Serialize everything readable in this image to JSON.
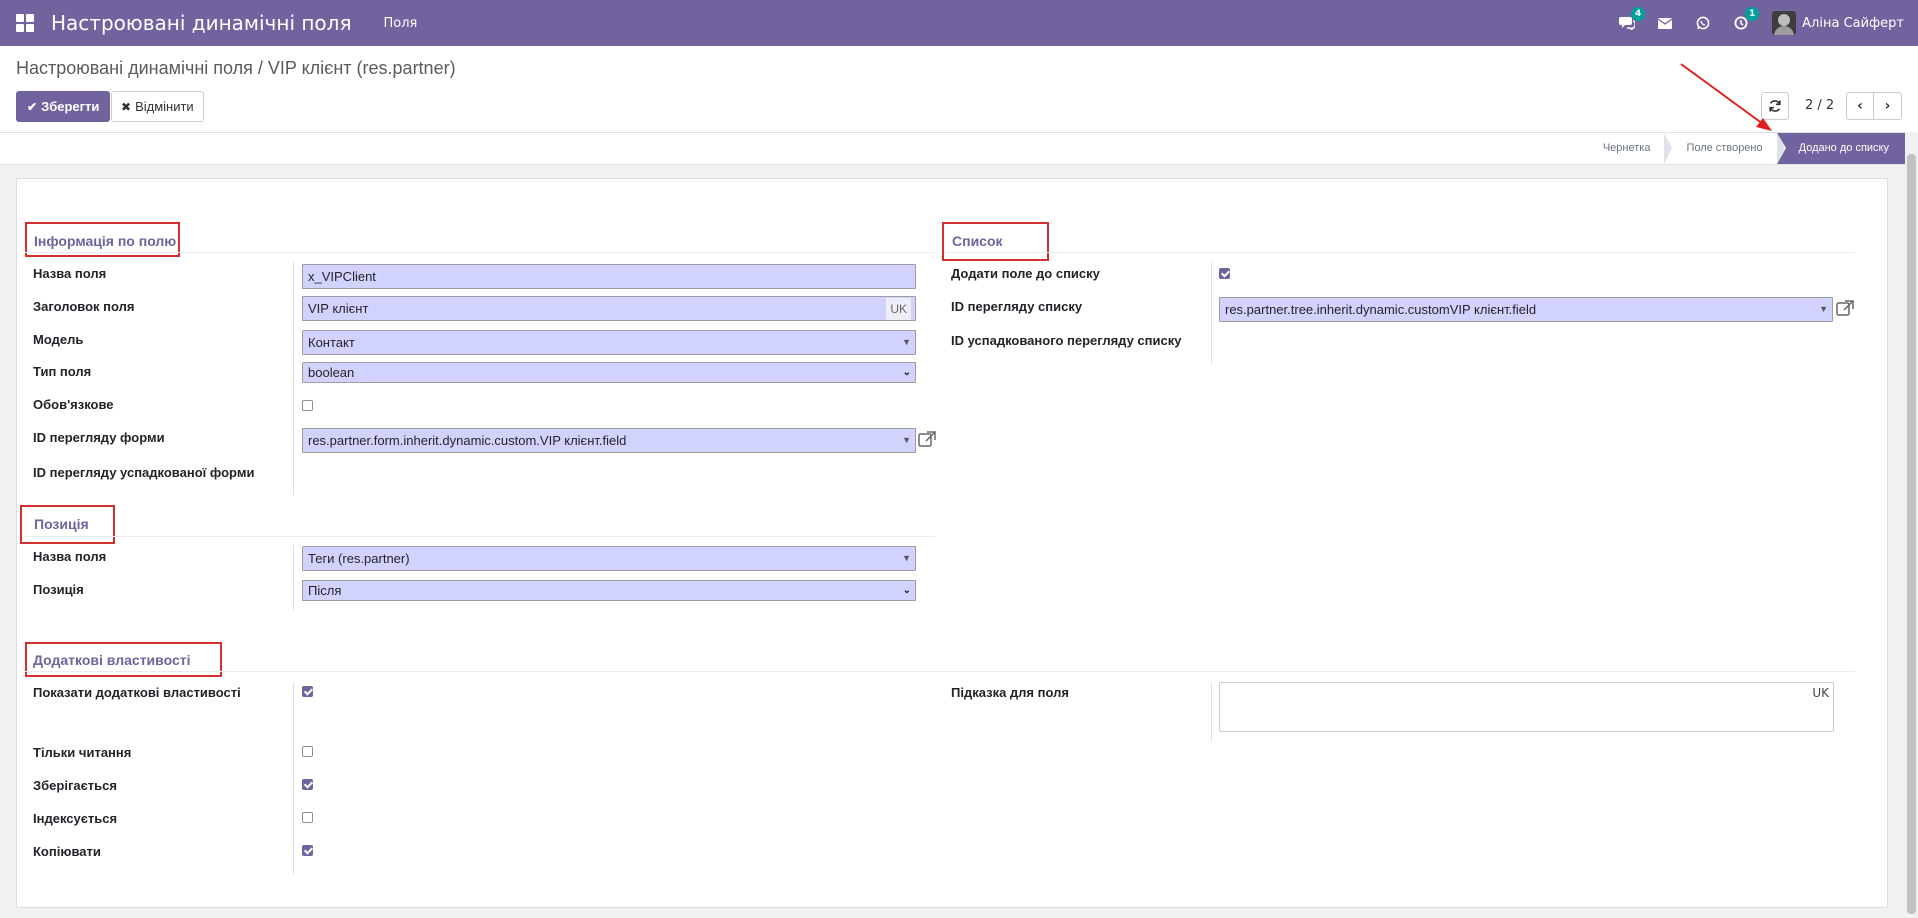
{
  "navbar": {
    "app_title": "Настроювані динамічні поля",
    "menu_item": "Поля",
    "chat_badge": "4",
    "activity_badge": "1",
    "user_name": "Аліна Сайферт",
    "icons": [
      "apps-icon",
      "chat-icon",
      "envelope-icon",
      "whatsapp-icon",
      "activity-icon"
    ]
  },
  "control": {
    "breadcrumb": "Настроювані динамічні поля / VIP клієнт (res.partner)",
    "save_label": "Зберегти",
    "cancel_label": "Відмінити",
    "pager_value": "2 / 2"
  },
  "statusbar": {
    "stages": [
      "Чернетка",
      "Поле створено",
      "Додано до списку"
    ],
    "active_stage": "Додано до списку"
  },
  "field_info": {
    "title": "Інформація по полю",
    "rows": [
      {
        "label": "Назва поля",
        "value": "x_VIPClient"
      },
      {
        "label": "Заголовок поля",
        "value": "VIP клієнт",
        "lang": "UK"
      },
      {
        "label": "Модель",
        "value": "Контакт"
      },
      {
        "label": "Тип поля",
        "value": "boolean"
      },
      {
        "label": "Обов'язкове",
        "checked": false
      },
      {
        "label": "ID перегляду форми",
        "value": "res.partner.form.inherit.dynamic.custom.VIP клієнт.field"
      },
      {
        "label": "ID перегляду успадкованої форми",
        "value": ""
      }
    ]
  },
  "position": {
    "title": "Позиція",
    "rows": [
      {
        "label": "Назва поля",
        "value": "Теги (res.partner)"
      },
      {
        "label": "Позиція",
        "value": "Після"
      }
    ]
  },
  "list_section": {
    "title": "Список",
    "rows": [
      {
        "label": "Додати поле до списку",
        "checked": true
      },
      {
        "label": "ID перегляду списку",
        "value": "res.partner.tree.inherit.dynamic.customVIP клієнт.field"
      },
      {
        "label": "ID успадкованого перегляду списку",
        "value": ""
      }
    ]
  },
  "extra": {
    "title": "Додаткові властивості",
    "rows": [
      {
        "label": "Показати додаткові властивості",
        "checked": true
      },
      {
        "label": "Тільки читання",
        "checked": false
      },
      {
        "label": "Зберігається",
        "checked": true
      },
      {
        "label": "Індексується",
        "checked": false
      },
      {
        "label": "Копіювати",
        "checked": true
      }
    ],
    "help_label": "Підказка для поля",
    "help_lang": "UK",
    "help_value": ""
  },
  "colors": {
    "brand": "#71639e",
    "highlight": "#d32f2f",
    "input_bg": "#d2d2ff"
  }
}
